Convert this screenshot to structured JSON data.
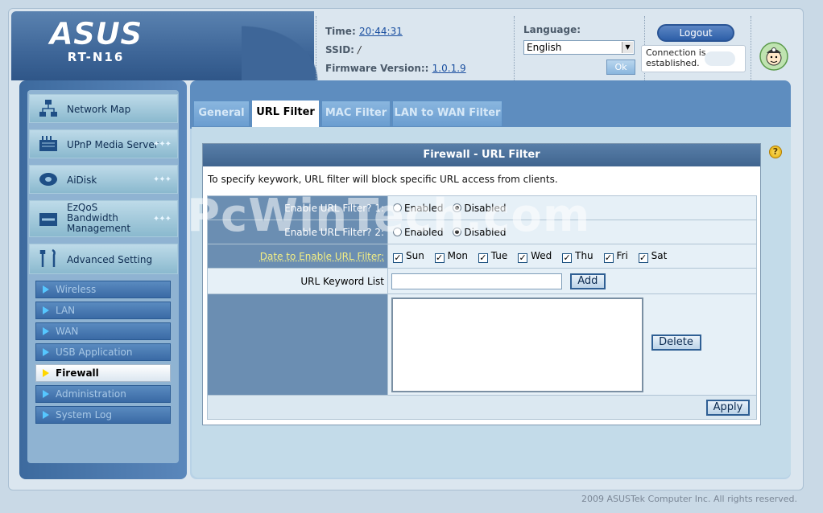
{
  "header": {
    "brand": "ASUS",
    "model": "RT-N16",
    "time_label": "Time:",
    "time_value": "20:44:31",
    "ssid_label": "SSID:",
    "ssid_value": "/",
    "firmware_label": "Firmware Version::",
    "firmware_value": "1.0.1.9",
    "language_label": "Language:",
    "language_value": "English",
    "ok_label": "Ok",
    "logout_label": "Logout",
    "connection_status": "Connection is established."
  },
  "sidebar": {
    "main_items": [
      {
        "label": "Network Map",
        "icon": "network-map-icon"
      },
      {
        "label": "UPnP Media Server",
        "icon": "media-server-icon"
      },
      {
        "label": "AiDisk",
        "icon": "aidisk-icon"
      },
      {
        "label": "EzQoS Bandwidth Management",
        "icon": "qos-icon"
      },
      {
        "label": "Advanced Setting",
        "icon": "tools-icon"
      }
    ],
    "sub_items": [
      {
        "label": "Wireless"
      },
      {
        "label": "LAN"
      },
      {
        "label": "WAN"
      },
      {
        "label": "USB Application"
      },
      {
        "label": "Firewall"
      },
      {
        "label": "Administration"
      },
      {
        "label": "System Log"
      }
    ]
  },
  "tabs": [
    {
      "label": "General"
    },
    {
      "label": "URL Filter"
    },
    {
      "label": "MAC Filter"
    },
    {
      "label": "LAN to WAN Filter"
    }
  ],
  "panel": {
    "title": "Firewall - URL Filter",
    "description": "To specify keywork, URL filter will block specific URL access from clients.",
    "filter1_label": "Enable URL Filter? 1:",
    "filter2_label": "Enable URL Filter? 2:",
    "enabled_label": "Enabled",
    "disabled_label": "Disabled",
    "date_label": "Date to Enable URL Filter:",
    "days": [
      "Sun",
      "Mon",
      "Tue",
      "Wed",
      "Thu",
      "Fri",
      "Sat"
    ],
    "keyword_label": "URL Keyword List",
    "keyword_value": "",
    "add_label": "Add",
    "delete_label": "Delete",
    "apply_label": "Apply"
  },
  "footer": {
    "copyright": "2009 ASUSTek Computer Inc. All rights reserved."
  },
  "watermark": "PcWinTech.com",
  "colors": {
    "accent": "#3e6698",
    "panel_header": "#4a6f98"
  }
}
